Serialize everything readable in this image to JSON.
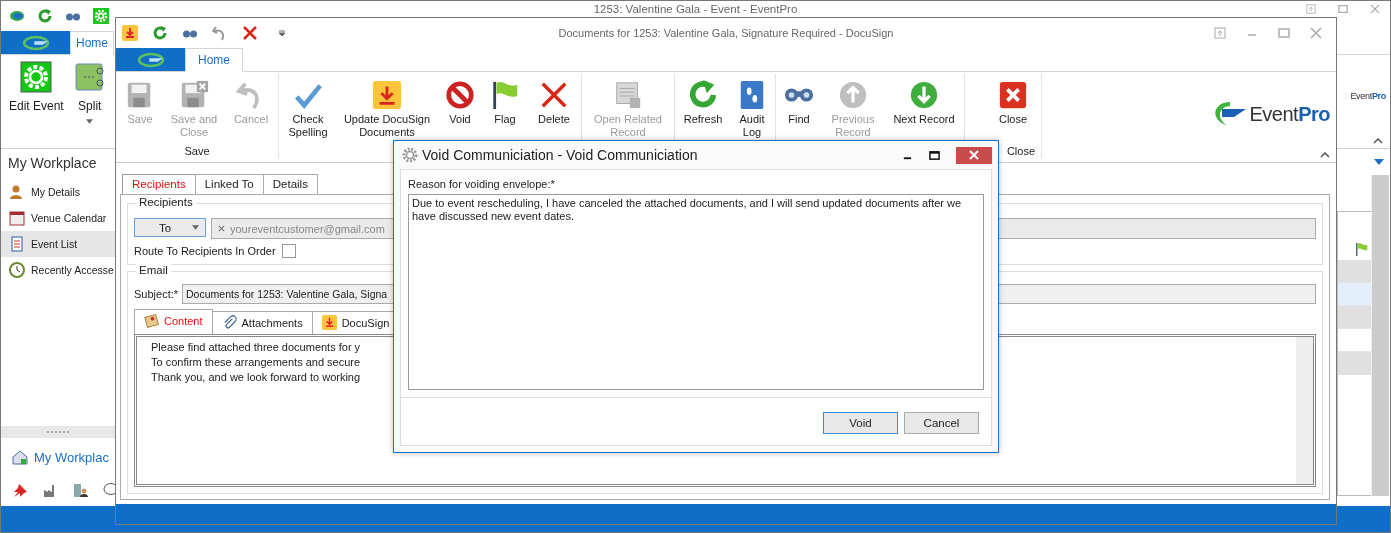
{
  "back_window": {
    "title": "1253: Valentine Gala - Event - EventPro",
    "ribbon_tab": {
      "label": "Home",
      "selected": true
    },
    "ribbon_buttons": [
      {
        "label": "Edit Event",
        "dropdown": false
      },
      {
        "label": "Split",
        "dropdown": true
      }
    ],
    "logo": "Event**Pro**",
    "sidebar": {
      "title": "My Workplace",
      "items": [
        {
          "label": "My Details",
          "selected": false
        },
        {
          "label": "Venue Calendar",
          "selected": false
        },
        {
          "label": "Event List",
          "selected": true
        },
        {
          "label": "Recently Accesse",
          "selected": false
        }
      ],
      "footer": "My Workplac"
    },
    "grid_rows": [
      {
        "selected": false
      },
      {
        "selected": true
      },
      {
        "selected": false
      },
      {
        "selected": false
      },
      {
        "selected": false
      }
    ]
  },
  "document_window": {
    "title": "Documents for 1253: Valentine Gala, Signature Required - DocuSign",
    "ribbon_tab": {
      "label": "Home",
      "selected": true
    },
    "ribbon_groups": [
      {
        "label": "Save",
        "buttons": [
          {
            "label": "Save",
            "disabled": true
          },
          {
            "label": "Save and Close",
            "disabled": true
          },
          {
            "label": "Cancel",
            "disabled": true
          }
        ]
      },
      {
        "buttons": [
          {
            "label": "Check Spelling",
            "disabled": false
          },
          {
            "label": "Update DocuSign Documents",
            "disabled": false
          },
          {
            "label": "Void",
            "disabled": false
          },
          {
            "label": "Flag",
            "disabled": false
          },
          {
            "label": "Delete",
            "disabled": false
          }
        ]
      },
      {
        "buttons": [
          {
            "label": "Open Related Record",
            "disabled": true
          }
        ]
      },
      {
        "buttons": [
          {
            "label": "Refresh",
            "disabled": false
          },
          {
            "label": "Audit Log",
            "disabled": false
          }
        ]
      },
      {
        "buttons": [
          {
            "label": "Find",
            "disabled": false
          },
          {
            "label": "Previous Record",
            "disabled": true
          },
          {
            "label": "Next Record",
            "disabled": false
          }
        ]
      },
      {
        "label": "Close",
        "buttons": [
          {
            "label": "Close",
            "disabled": false
          }
        ]
      }
    ],
    "logo": "Event**Pro**",
    "tabs": [
      {
        "label": "Recipients",
        "selected": true
      },
      {
        "label": "Linked To",
        "selected": false
      },
      {
        "label": "Details",
        "selected": false
      }
    ],
    "recipients": {
      "title": "Recipients",
      "type": "To",
      "recipient": "youreventcustomer@gmail.com",
      "route_in_order": {
        "label": "Route To Recipients In Order",
        "checked": false
      }
    },
    "email": {
      "title": "Email",
      "subject_label": "Subject:*",
      "subject": "Documents for 1253: Valentine Gala, Signa",
      "tabs": [
        {
          "label": "Content",
          "selected": true
        },
        {
          "label": "Attachments",
          "selected": false
        },
        {
          "label": "DocuSign",
          "selected": false
        }
      ],
      "content_lines": [
        "Please find attached three documents for y",
        "To confirm these arrangements and secure",
        "Thank you, and we look forward to working"
      ]
    }
  },
  "dialog": {
    "title": "Void Communiciation - Void Communiciation",
    "field_label": "Reason for voiding envelope:*",
    "reason": "Due to event rescheduling, I have canceled the attached documents, and I will send updated documents after we have discussed new event dates.",
    "buttons": [
      {
        "label": "Void",
        "default": true
      },
      {
        "label": "Cancel",
        "default": false
      }
    ]
  }
}
